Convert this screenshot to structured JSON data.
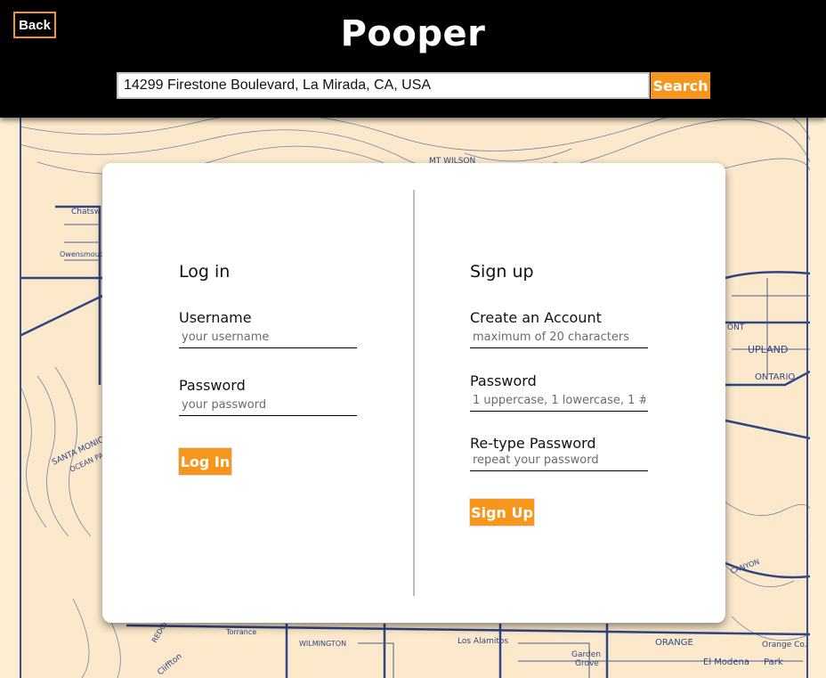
{
  "header": {
    "back_label": "Back",
    "title": "Pooper",
    "search_value": "14299 Firestone Boulevard, La Mirada, CA, USA",
    "search_button": "Search"
  },
  "map_labels": [
    "MT WILSON",
    "Chatsw",
    "Owensmouth",
    "SANTA MONICA",
    "OCEAN PA",
    "ONT",
    "UPLAND",
    "ONTARIO",
    "REDON",
    "Torrance",
    "WILMINGTON",
    "Los Alamitos",
    "Garden Grove",
    "ORANGE",
    "Orange Co.",
    "El Modena",
    "Park",
    "Cliffton",
    "CANYON"
  ],
  "login": {
    "title": "Log in",
    "username_label": "Username",
    "username_placeholder": "your username",
    "password_label": "Password",
    "password_placeholder": "your password",
    "button": "Log In"
  },
  "signup": {
    "title": "Sign up",
    "account_label": "Create an Account",
    "account_placeholder": "maximum of 20 characters",
    "password_label": "Password",
    "password_placeholder": "1 uppercase, 1 lowercase, 1 #",
    "retype_label": "Re-type Password",
    "retype_placeholder": "repeat your password",
    "button": "Sign Up"
  },
  "colors": {
    "accent": "#f6961d",
    "header_bg": "#000000",
    "map_bg": "#fce9cb",
    "map_ink": "#3a4f86"
  }
}
